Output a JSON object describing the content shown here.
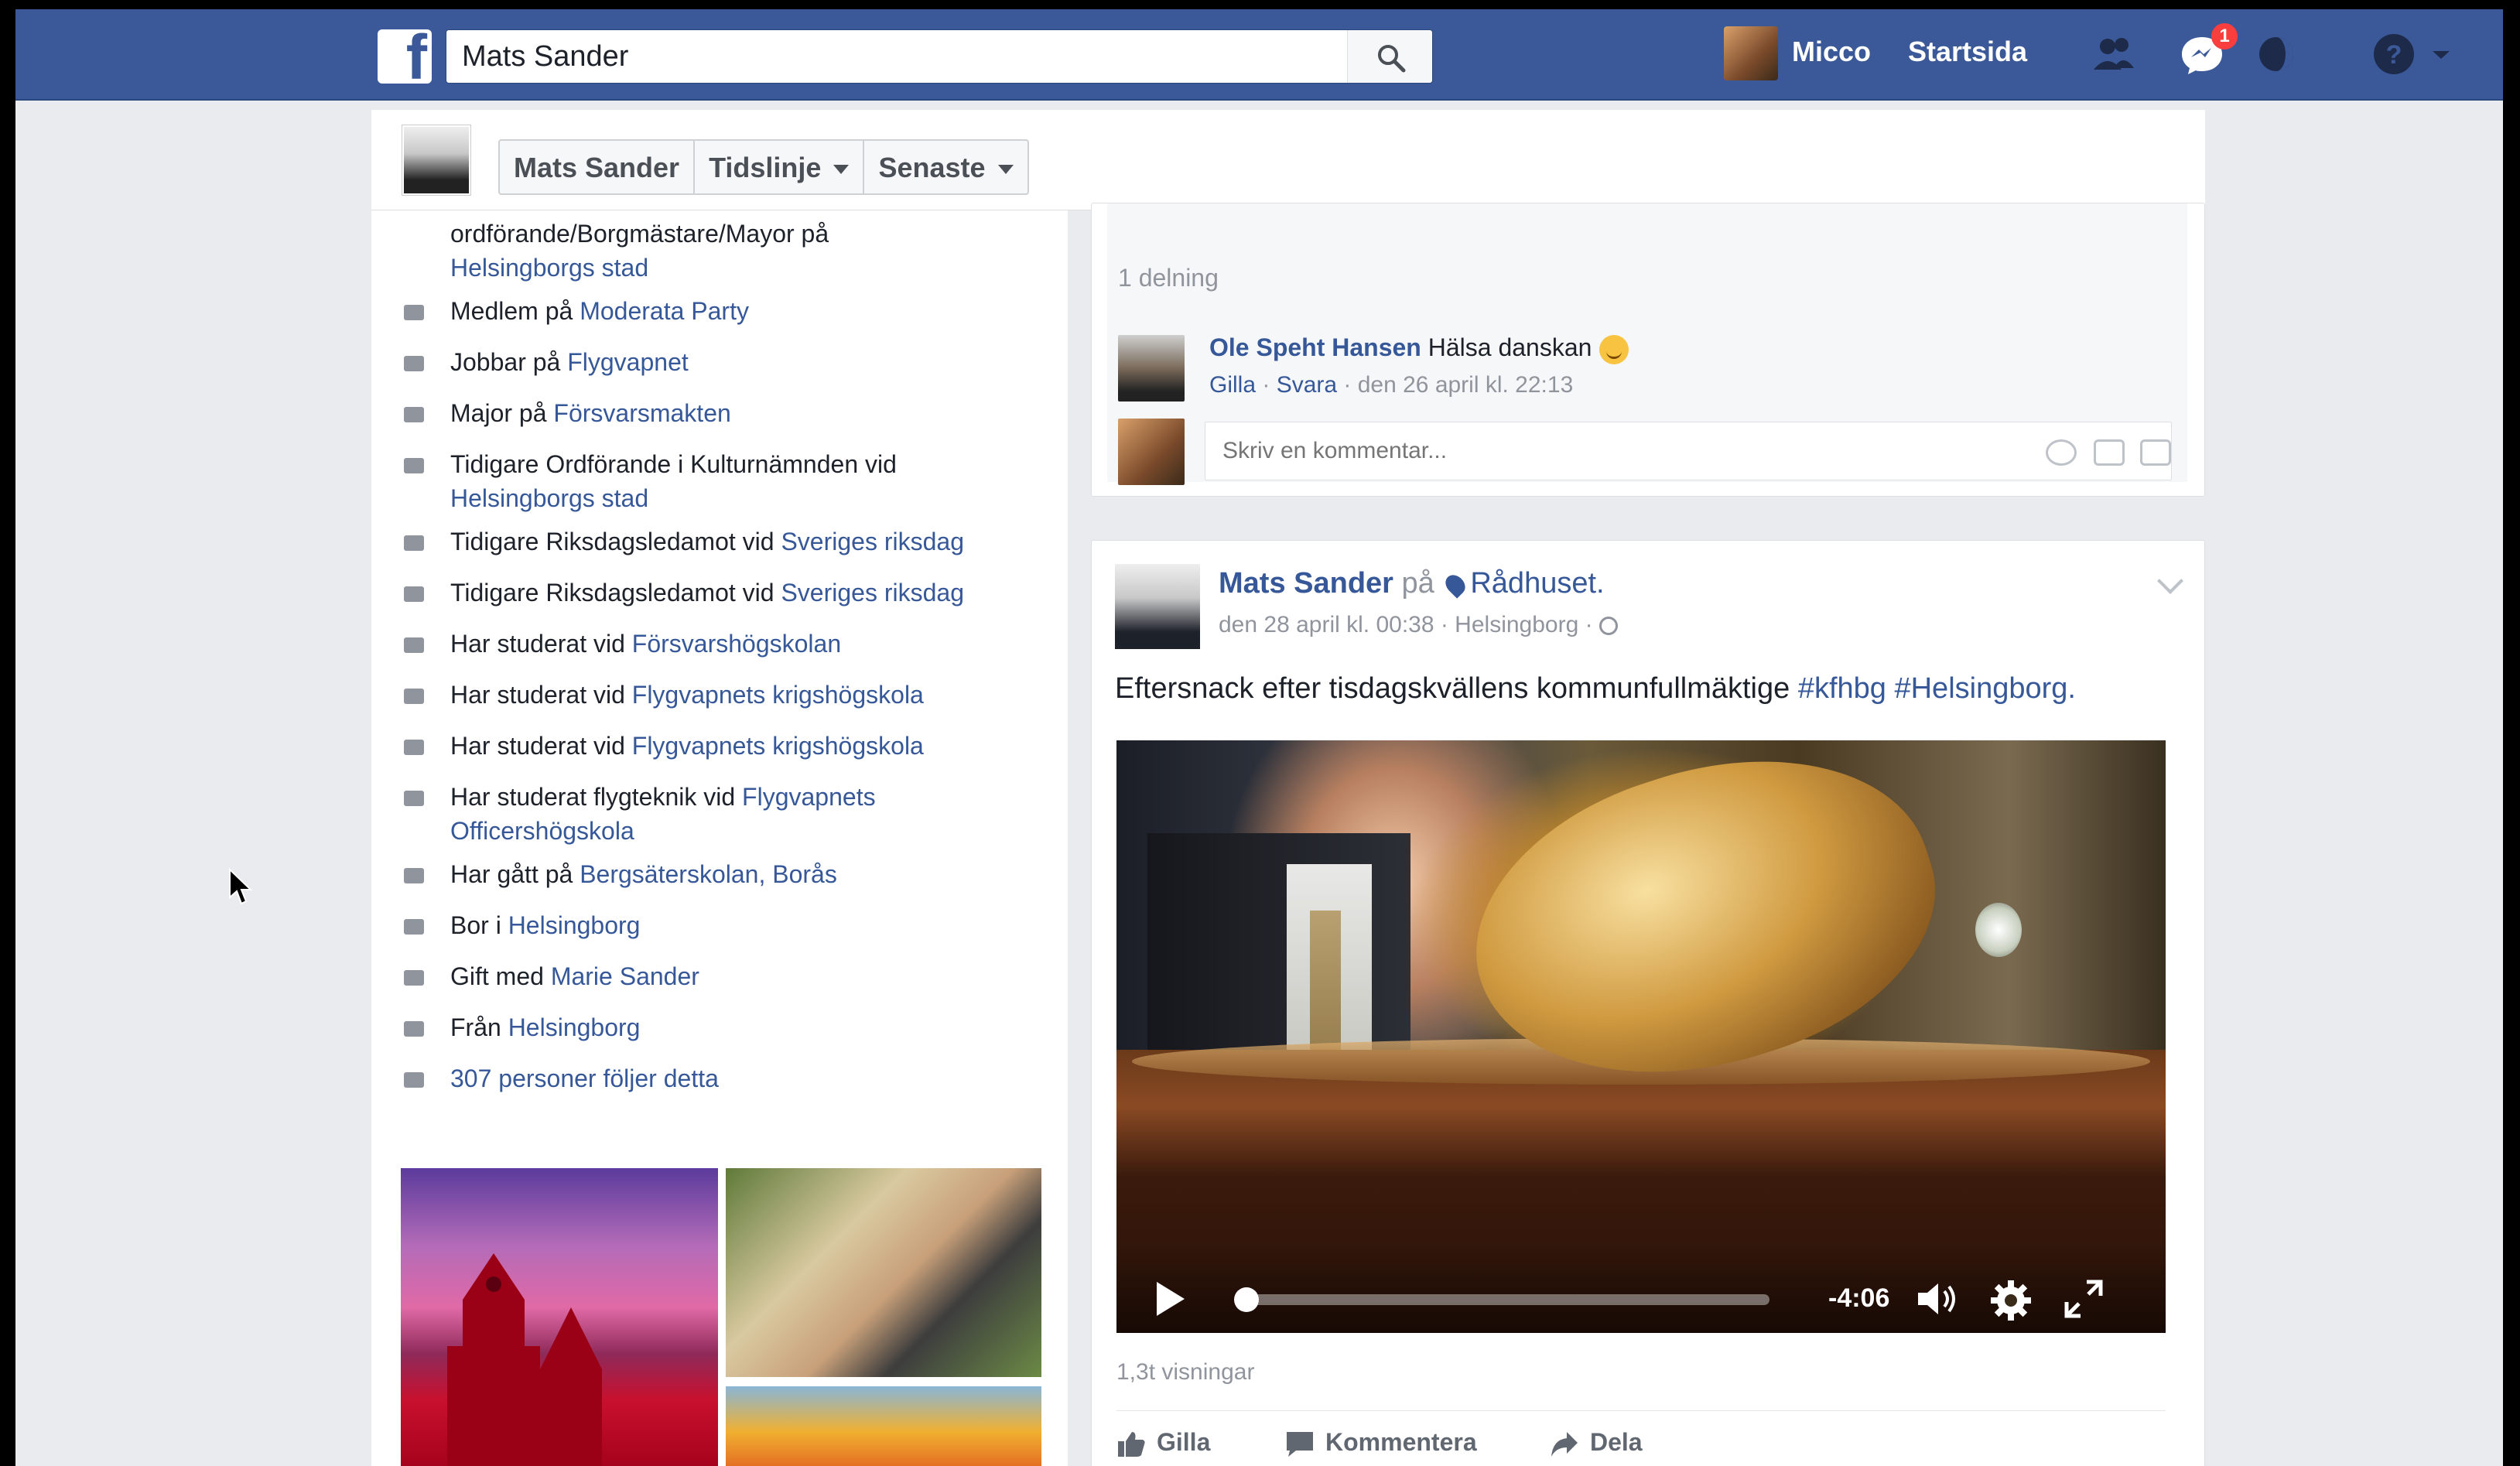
{
  "topbar": {
    "search_value": "Mats Sander",
    "user_name": "Micco",
    "home_label": "Startsida",
    "notification_count": "1"
  },
  "profile_bar": {
    "name_button": "Mats Sander",
    "timeline_button": "Tidslinje",
    "recent_button": "Senaste"
  },
  "intro": {
    "items": [
      {
        "icon": "briefcase-icon",
        "text": "ordförande/Borgmästare/Mayor på",
        "link": "Helsingborgs stad"
      },
      {
        "icon": "briefcase-icon",
        "text": "Medlem på ",
        "link": "Moderata Party"
      },
      {
        "icon": "briefcase-icon",
        "text": "Jobbar på ",
        "link": "Flygvapnet"
      },
      {
        "icon": "briefcase-icon",
        "text": "Major på ",
        "link": "Försvarsmakten"
      },
      {
        "icon": "briefcase-icon",
        "text": "Tidigare Ordförande i Kulturnämnden vid",
        "link": "Helsingborgs stad"
      },
      {
        "icon": "briefcase-icon",
        "text": "Tidigare Riksdagsledamot vid ",
        "link": "Sveriges riksdag"
      },
      {
        "icon": "briefcase-icon",
        "text": "Tidigare Riksdagsledamot vid ",
        "link": "Sveriges riksdag"
      },
      {
        "icon": "school-icon",
        "text": "Har studerat vid ",
        "link": "Försvarshögskolan"
      },
      {
        "icon": "school-icon",
        "text": "Har studerat vid ",
        "link": "Flygvapnets krigshögskola"
      },
      {
        "icon": "school-icon",
        "text": "Har studerat vid ",
        "link": "Flygvapnets krigshögskola"
      },
      {
        "icon": "school-icon",
        "text": "Har studerat flygteknik vid ",
        "link": "Flygvapnets Officershögskola"
      },
      {
        "icon": "school-icon",
        "text": "Har gått på ",
        "link": "Bergsäterskolan, Borås"
      },
      {
        "icon": "home-icon",
        "text": "Bor i ",
        "link": "Helsingborg"
      },
      {
        "icon": "heart-icon",
        "text": "Gift med ",
        "link": "Marie Sander"
      },
      {
        "icon": "location-icon",
        "text": "Från ",
        "link": "Helsingborg"
      },
      {
        "icon": "followers-icon",
        "text": "",
        "link": "307 personer följer detta"
      }
    ]
  },
  "feed": {
    "prev_post": {
      "share_count": "1 delning",
      "comment_author": "Ole Speht Hansen",
      "comment_text": " Hälsa danskan",
      "like_label": "Gilla",
      "reply_label": "Svara",
      "comment_time": " · den 26 april kl. 22:13",
      "comment_placeholder": "Skriv en kommentar..."
    },
    "post": {
      "author": "Mats Sander",
      "at_word": " på ",
      "place": "Rådhuset.",
      "meta": "den 28 april kl. 00:38 · Helsingborg ·",
      "text": "Eftersnack efter tisdagskvällens kommunfullmäktige ",
      "tags": "#kfhbg #Helsingborg.",
      "video_time": "-4:06",
      "video_progress_fraction": 0.02,
      "views": "1,3t visningar",
      "like_label": "Gilla",
      "comment_label": "Kommentera",
      "share_label": "Dela"
    }
  },
  "colors": {
    "brand_blue": "#3b5998",
    "link_blue": "#365899",
    "background": "#e9ebee"
  }
}
